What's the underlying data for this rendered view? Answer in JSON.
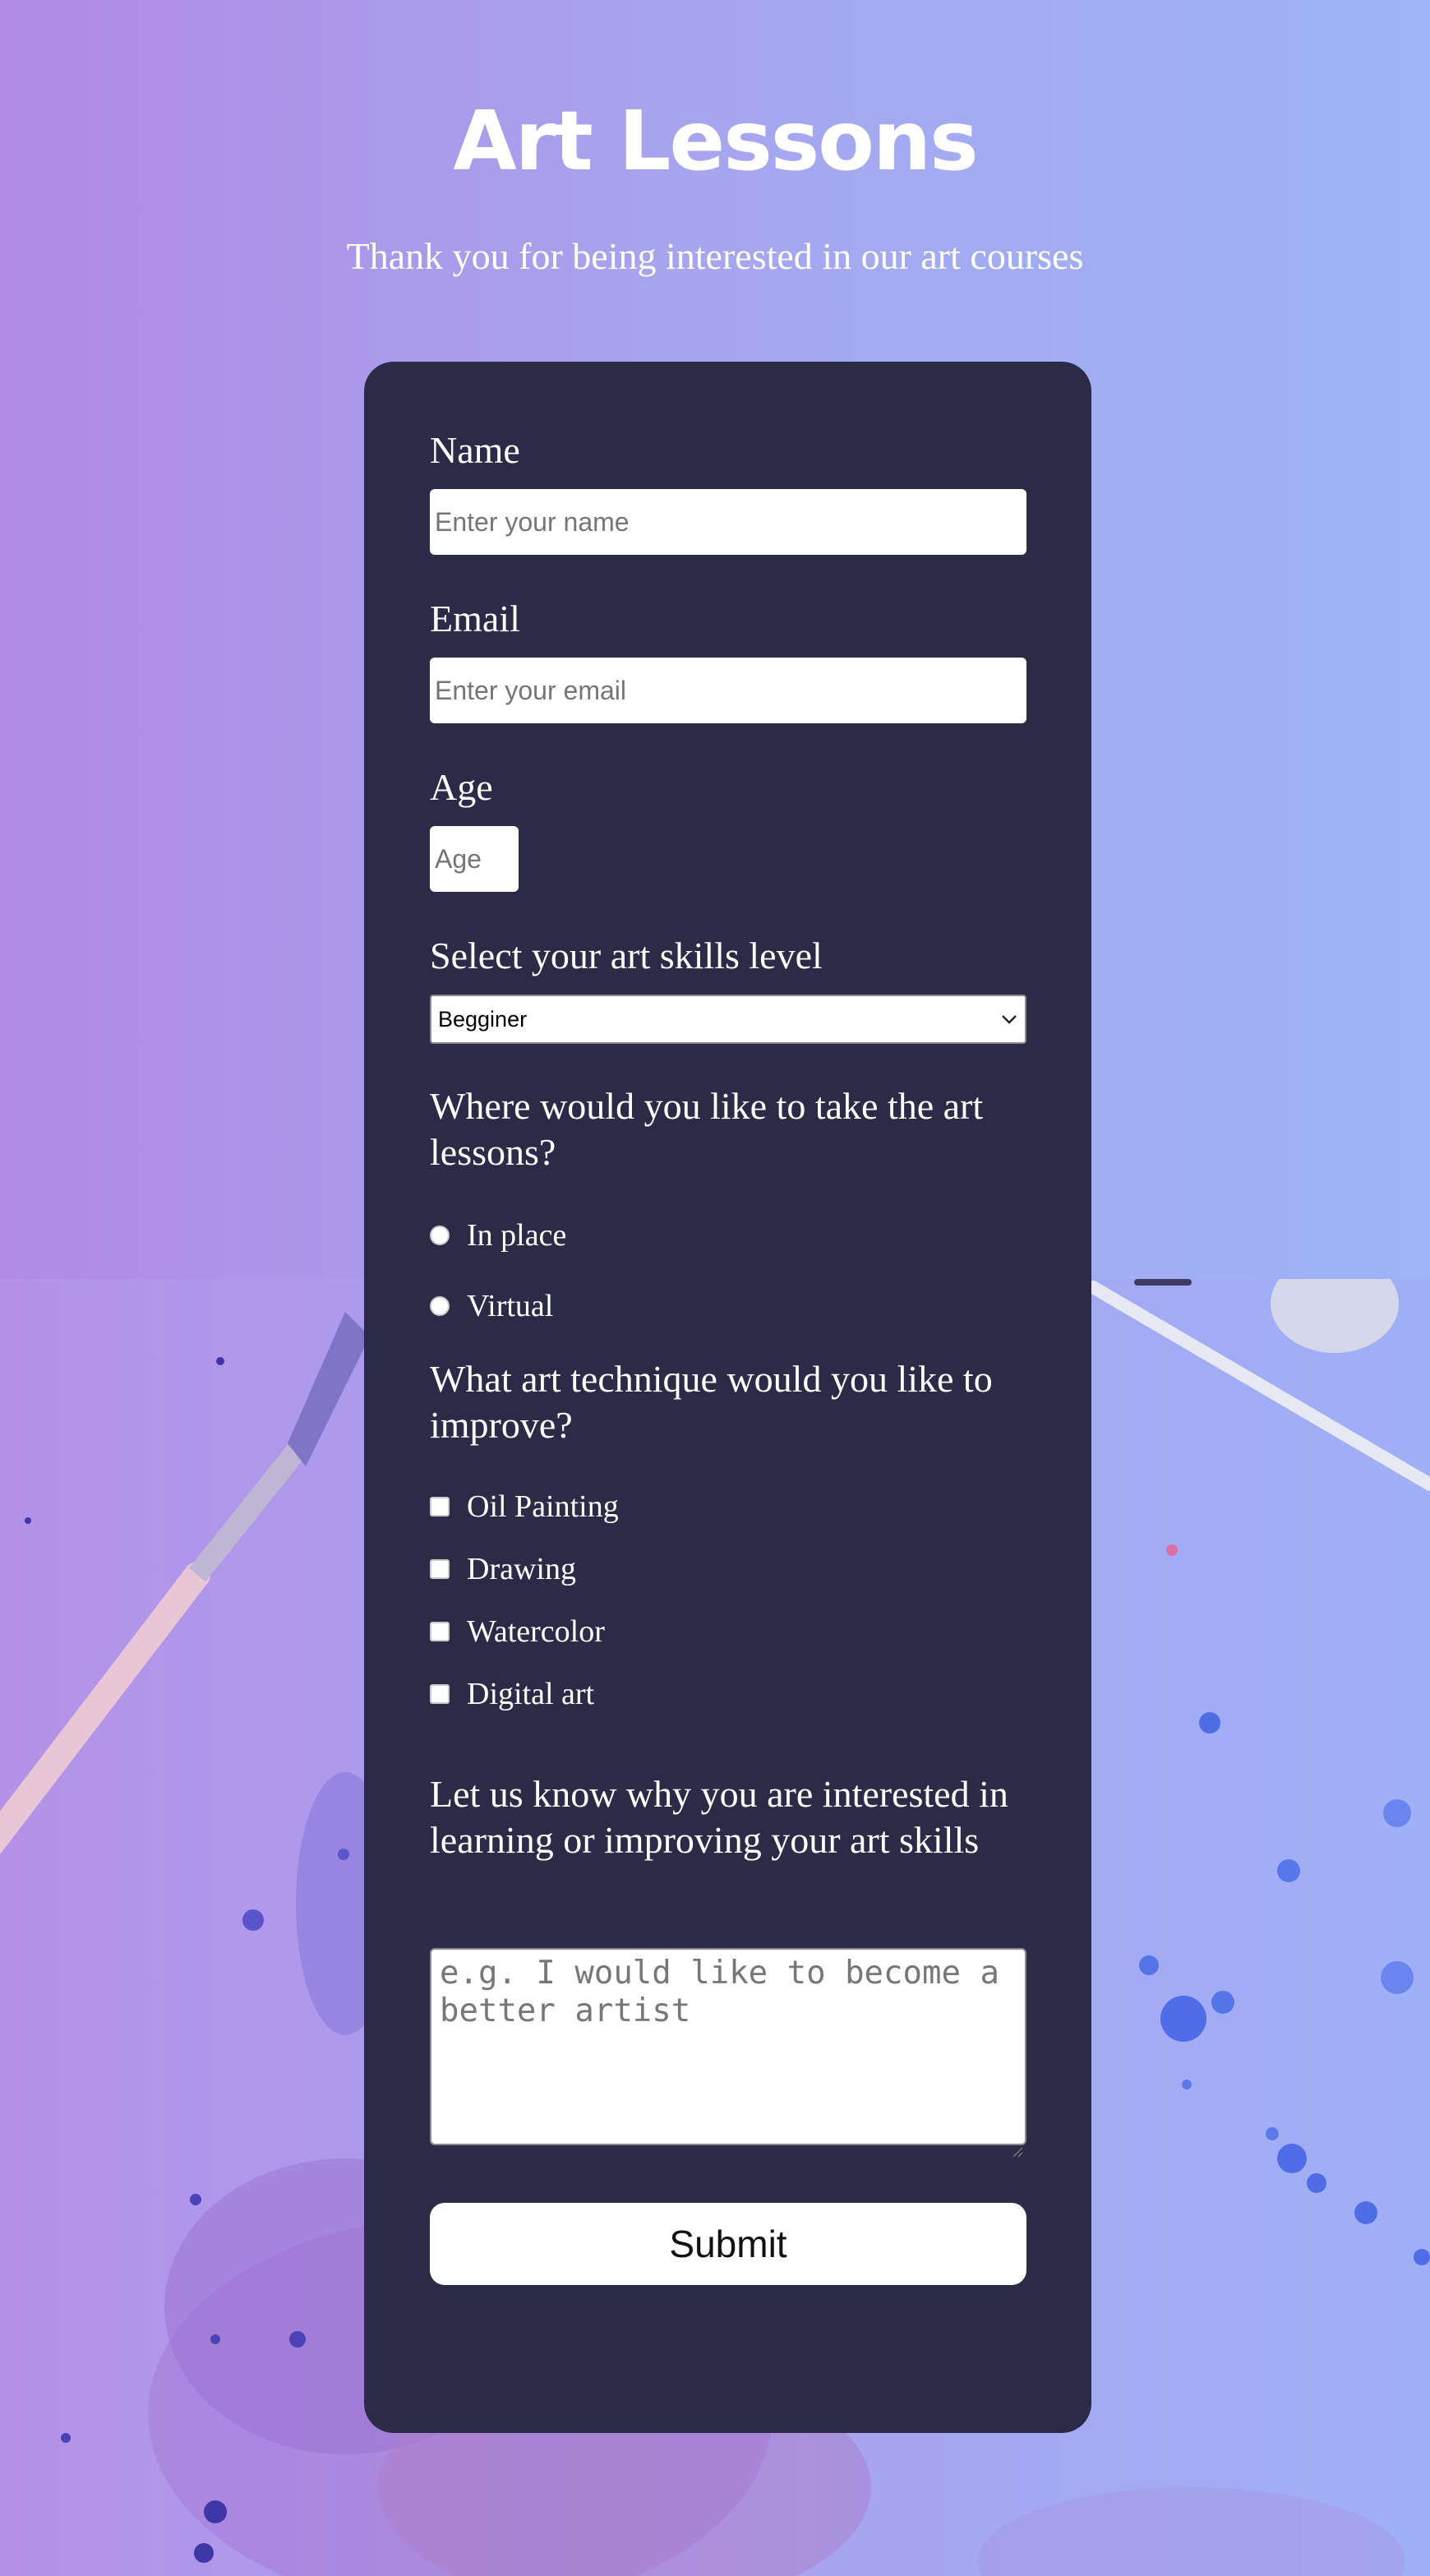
{
  "header": {
    "title": "Art Lessons",
    "subtitle": "Thank you for being interested in our art courses"
  },
  "form": {
    "name": {
      "label": "Name",
      "placeholder": "Enter your name",
      "value": ""
    },
    "email": {
      "label": "Email",
      "placeholder": "Enter your email",
      "value": ""
    },
    "age": {
      "label": "Age",
      "placeholder": "Age",
      "value": ""
    },
    "skill": {
      "label": "Select your art skills level",
      "selected": "Begginer"
    },
    "location": {
      "question": "Where would you like to take the art lessons?",
      "options": [
        "In place",
        "Virtual"
      ]
    },
    "technique": {
      "question": "What art technique would you like to improve?",
      "options": [
        "Oil Painting",
        "Drawing",
        "Watercolor",
        "Digital art"
      ]
    },
    "reason": {
      "question": "Let us know why you are interested in learning or improving your art skills",
      "placeholder": "e.g. I would like to become a better artist"
    },
    "submit_label": "Submit"
  },
  "colors": {
    "card_background": "#2b2a47",
    "gradient_left": "#b18ae4",
    "gradient_right": "#9db4f6"
  }
}
